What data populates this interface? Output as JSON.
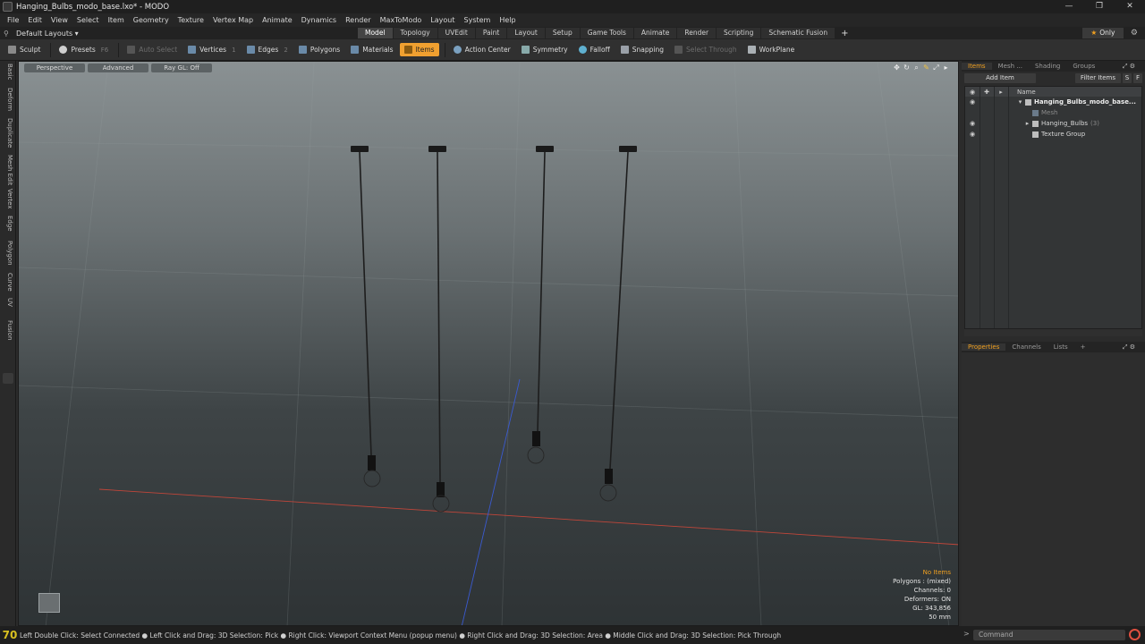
{
  "window": {
    "title": "Hanging_Bulbs_modo_base.lxo* - MODO",
    "minimize": "—",
    "maximize": "❐",
    "close": "✕"
  },
  "menu": [
    "File",
    "Edit",
    "View",
    "Select",
    "Item",
    "Geometry",
    "Texture",
    "Vertex Map",
    "Animate",
    "Dynamics",
    "Render",
    "MaxToModo",
    "Layout",
    "System",
    "Help"
  ],
  "layout_row": {
    "layouts_label": "Default Layouts ▾",
    "tabs": [
      {
        "label": "Model",
        "active": true
      },
      {
        "label": "Topology",
        "active": false
      },
      {
        "label": "UVEdit",
        "active": false
      },
      {
        "label": "Paint",
        "active": false
      },
      {
        "label": "Layout",
        "active": false
      },
      {
        "label": "Setup",
        "active": false
      },
      {
        "label": "Game Tools",
        "active": false
      },
      {
        "label": "Animate",
        "active": false
      },
      {
        "label": "Render",
        "active": false
      },
      {
        "label": "Scripting",
        "active": false
      },
      {
        "label": "Schematic Fusion",
        "active": false
      }
    ],
    "only_label": "Only"
  },
  "toolbar": {
    "sculpt": "Sculpt",
    "presets": "Presets",
    "presets_key": "F6",
    "auto_select": "Auto Select",
    "vertices": "Vertices",
    "vertices_key": "1",
    "edges": "Edges",
    "edges_key": "2",
    "polygons": "Polygons",
    "materials": "Materials",
    "items": "Items",
    "action_center": "Action Center",
    "symmetry": "Symmetry",
    "falloff": "Falloff",
    "snapping": "Snapping",
    "select_through": "Select Through",
    "workplane": "WorkPlane"
  },
  "left_tabs": [
    "Basic",
    "Deform",
    "Duplicate",
    "Mesh Edit",
    "Vertex",
    "Edge",
    "Polygon",
    "Curve",
    "UV",
    "Fusion"
  ],
  "viewport": {
    "view_mode": "Perspective",
    "shading": "Advanced",
    "raygl": "Ray GL: Off",
    "info": {
      "selection": "No Items",
      "polygons": "Polygons : (mixed)",
      "channels": "Channels: 0",
      "deformers": "Deformers: ON",
      "gl": "GL: 343,856",
      "focal": "50 mm"
    }
  },
  "items_panel": {
    "tabs": [
      {
        "label": "Items",
        "active": true
      },
      {
        "label": "Mesh ...",
        "active": false
      },
      {
        "label": "Shading",
        "active": false
      },
      {
        "label": "Groups",
        "active": false
      }
    ],
    "add_item": "Add Item",
    "filter_items": "Filter Items",
    "btn_s": "S",
    "btn_f": "F",
    "name_header": "Name",
    "rows": [
      {
        "label": "Hanging_Bulbs_modo_base...",
        "indent": 0,
        "arrow": "▾",
        "bold": true,
        "count": ""
      },
      {
        "label": "Mesh",
        "indent": 1,
        "arrow": "",
        "bold": false,
        "count": ""
      },
      {
        "label": "Hanging_Bulbs",
        "indent": 1,
        "arrow": "▸",
        "bold": false,
        "count": "(3)"
      },
      {
        "label": "Texture Group",
        "indent": 1,
        "arrow": "",
        "bold": false,
        "count": ""
      }
    ]
  },
  "props_panel": {
    "tabs": [
      {
        "label": "Properties",
        "active": true
      },
      {
        "label": "Channels",
        "active": false
      },
      {
        "label": "Lists",
        "active": false
      }
    ]
  },
  "status": {
    "fps": "70",
    "hint": "Left Double Click: Select Connected ● Left Click and Drag: 3D Selection: Pick ● Right Click: Viewport Context Menu (popup menu) ● Right Click and Drag: 3D Selection: Area ● Middle Click and Drag: 3D Selection: Pick Through",
    "command_placeholder": "Command"
  }
}
